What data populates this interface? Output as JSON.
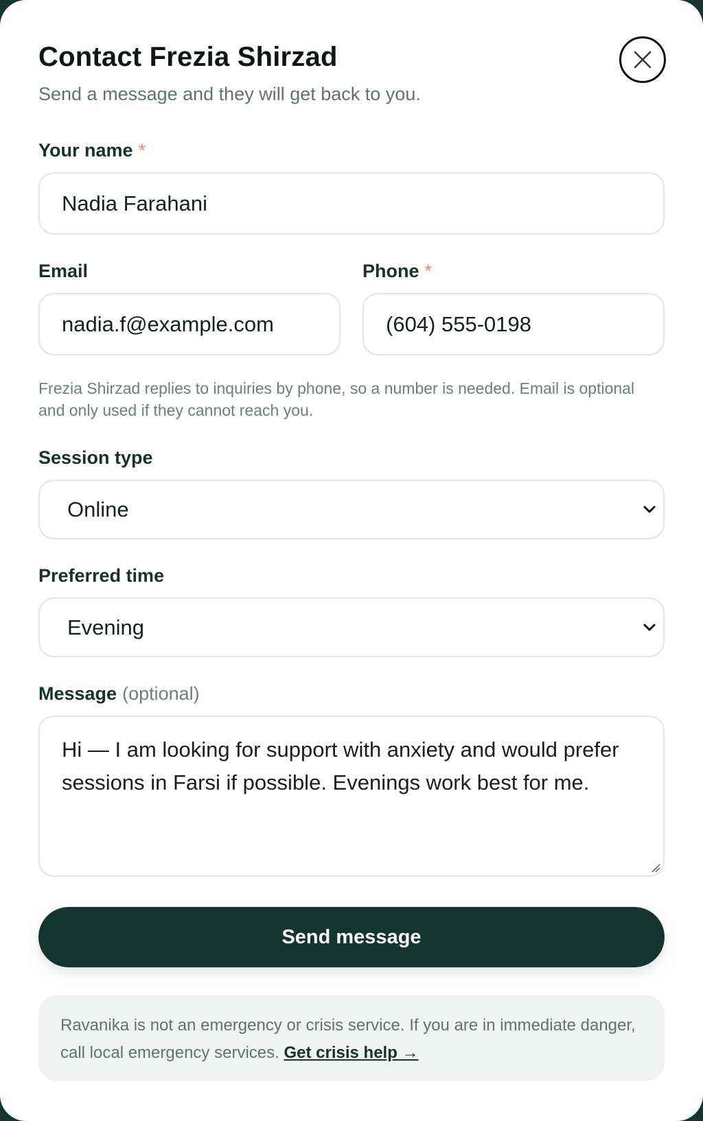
{
  "dialog": {
    "title": "Contact Frezia Shirzad",
    "subtitle": "Send a message and they will get back to you.",
    "close_icon": "close-icon"
  },
  "form": {
    "name": {
      "label": "Your name",
      "required_mark": "*",
      "value": "Nadia Farahani"
    },
    "email": {
      "label": "Email",
      "value": "nadia.f@example.com"
    },
    "phone": {
      "label": "Phone",
      "required_mark": "*",
      "value": "(604) 555-0198"
    },
    "helper_text": "Frezia Shirzad replies to inquiries by phone, so a number is needed. Email is optional and only used if they cannot reach you.",
    "session_type": {
      "label": "Session type",
      "selected": "Online"
    },
    "preferred_time": {
      "label": "Preferred time",
      "selected": "Evening"
    },
    "message": {
      "label": "Message",
      "optional_note": "(optional)",
      "value": "Hi — I am looking for support with anxiety and would prefer sessions in Farsi if possible. Evenings work best for me."
    },
    "submit_label": "Send message"
  },
  "notice": {
    "text": "Ravanika is not an emergency or crisis service. If you are in immediate danger, call local emergency services.",
    "link_label": "Get crisis help →"
  },
  "colors": {
    "primary": "#173530",
    "required": "#e8897a",
    "muted_text": "#5d7470",
    "notice_bg": "#eff3f1"
  }
}
